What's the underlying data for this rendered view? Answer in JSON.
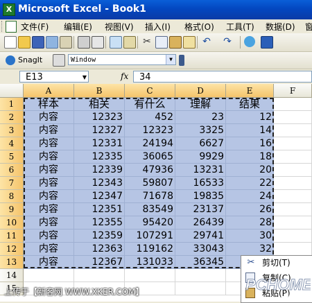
{
  "window": {
    "title": "Microsoft Excel - Book1",
    "app_icon": "excel-icon"
  },
  "menubar": {
    "items": [
      "文件(F)",
      "编辑(E)",
      "视图(V)",
      "插入(I)",
      "格式(O)",
      "工具(T)",
      "数据(D)",
      "窗"
    ]
  },
  "snagit": {
    "label": "SnagIt",
    "mode": "Window"
  },
  "formula_bar": {
    "name_box": "E13",
    "fx": "fx",
    "value": "34"
  },
  "grid": {
    "columns": [
      "A",
      "B",
      "C",
      "D",
      "E",
      "F"
    ],
    "rows": [
      "1",
      "2",
      "3",
      "4",
      "5",
      "6",
      "7",
      "8",
      "9",
      "10",
      "11",
      "12",
      "13",
      "14",
      "15"
    ],
    "header_row": [
      "样本",
      "相关",
      "有什么",
      "理解",
      "结果"
    ],
    "data": [
      [
        "内容",
        "12323",
        "452",
        "23",
        "12"
      ],
      [
        "内容",
        "12327",
        "12323",
        "3325",
        "14"
      ],
      [
        "内容",
        "12331",
        "24194",
        "6627",
        "16"
      ],
      [
        "内容",
        "12335",
        "36065",
        "9929",
        "18"
      ],
      [
        "内容",
        "12339",
        "47936",
        "13231",
        "20"
      ],
      [
        "内容",
        "12343",
        "59807",
        "16533",
        "22"
      ],
      [
        "内容",
        "12347",
        "71678",
        "19835",
        "24"
      ],
      [
        "内容",
        "12351",
        "83549",
        "23137",
        "26"
      ],
      [
        "内容",
        "12355",
        "95420",
        "26439",
        "28"
      ],
      [
        "内容",
        "12359",
        "107291",
        "29741",
        "30"
      ],
      [
        "内容",
        "12363",
        "119162",
        "33043",
        "32"
      ],
      [
        "内容",
        "12367",
        "131033",
        "36345",
        ""
      ]
    ]
  },
  "context_menu": {
    "items": [
      {
        "label": "剪切(T)",
        "icon": "scissors-icon"
      },
      {
        "label": "复制(C)",
        "icon": "copy-icon"
      },
      {
        "label": "粘贴(P)",
        "icon": "paste-icon"
      }
    ]
  },
  "watermark": {
    "left": "上传于【新客网 WWW.XKER.COM】",
    "right": "PCHOME",
    "right_sub": "NET"
  },
  "colors": {
    "selection": "#b6c5e4",
    "header_selected": "#f5c46b",
    "titlebar": "#0a4fc8"
  }
}
